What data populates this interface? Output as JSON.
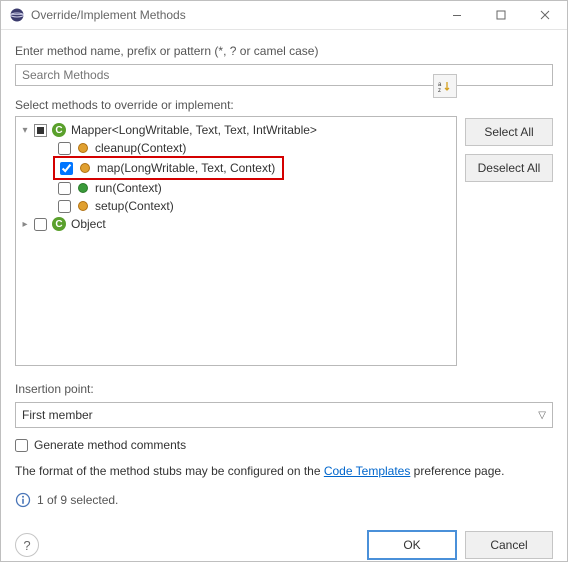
{
  "titlebar": {
    "title": "Override/Implement Methods"
  },
  "enter_label": "Enter method name, prefix or pattern (*, ? or camel case)",
  "search": {
    "placeholder": "Search Methods"
  },
  "select_label": "Select methods to override or implement:",
  "sort_icon": "sort-alpha-icon",
  "side": {
    "select_all": "Select All",
    "deselect_all": "Deselect All"
  },
  "tree": {
    "root1": {
      "label": "Mapper<LongWritable, Text, Text, IntWritable>"
    },
    "m_cleanup": "cleanup(Context)",
    "m_map": "map(LongWritable, Text, Context)",
    "m_run": "run(Context)",
    "m_setup": "setup(Context)",
    "root2": {
      "label": "Object"
    }
  },
  "insertion": {
    "label": "Insertion point:",
    "value": "First member"
  },
  "generate": {
    "label": "Generate method comments"
  },
  "format": {
    "prefix": "The format of the method stubs may be configured on the ",
    "link": "Code Templates",
    "suffix": " preference page."
  },
  "info": "1 of 9 selected.",
  "buttons": {
    "ok": "OK",
    "cancel": "Cancel"
  }
}
